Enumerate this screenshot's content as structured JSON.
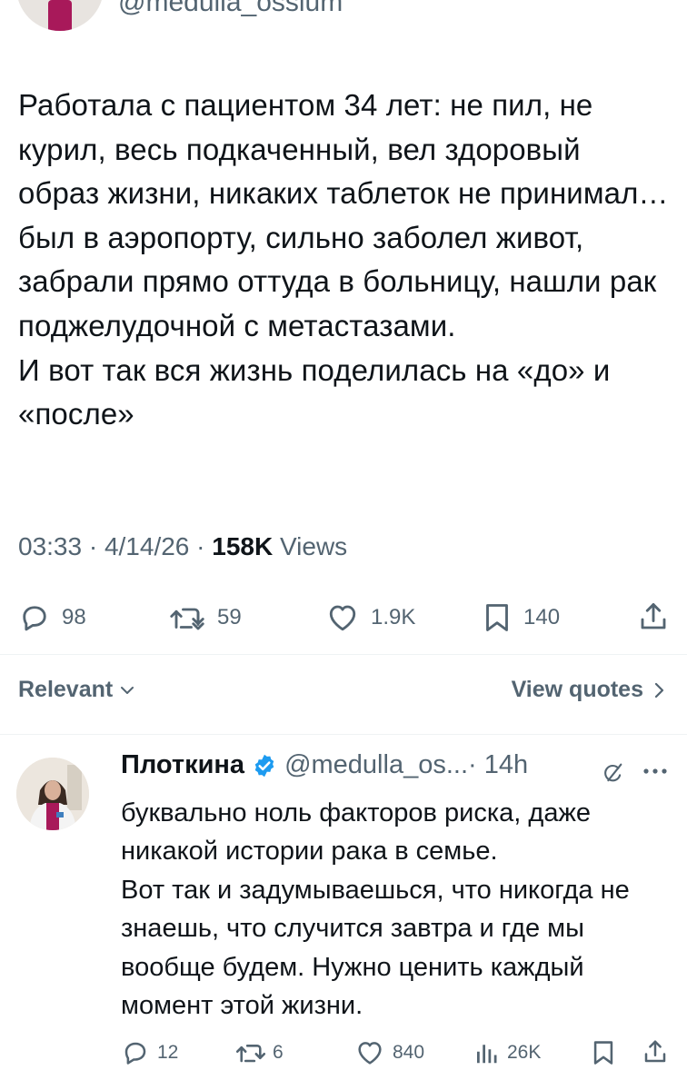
{
  "main_tweet": {
    "handle": "@medulla_ossium",
    "text": "Работала с пациентом 34 лет: не пил, не курил, весь подкаченный, вел здоровый образ жизни, никаких таблеток не принимал…был в аэропорту, сильно заболел живот, забрали прямо оттуда в больницу, нашли рак поджелудочной с метастазами.\nИ вот так вся жизнь поделилась на «до» и «после»",
    "time": "03:33 · 4/14/26 · ",
    "views_count": "158K",
    "views_label": " Views",
    "actions": {
      "replies": "98",
      "reposts": "59",
      "likes": "1.9K",
      "bookmarks": "140"
    }
  },
  "sort": {
    "relevant_label": "Relevant",
    "view_quotes_label": "View quotes"
  },
  "reply": {
    "name": "Плоткина",
    "handle": "@medulla_os...",
    "time": " · 14h",
    "text": "буквально ноль факторов риска, даже никакой истории рака в семье.\nВот так и задумываешься, что никогда не знаешь, что случится завтра и где мы вообще будем. Нужно ценить каждый момент этой жизни.",
    "actions": {
      "replies": "12",
      "reposts": "6",
      "likes": "840",
      "views": "26K"
    }
  },
  "colors": {
    "text": "#0f1419",
    "secondary": "#536471",
    "verified": "#1d9bf0",
    "divider": "#eff3f4"
  },
  "icons": [
    "reply-icon",
    "repost-icon",
    "like-icon",
    "bookmark-icon",
    "share-icon",
    "chevron-down-icon",
    "chevron-right-icon",
    "verified-icon",
    "grok-icon",
    "more-icon",
    "views-icon"
  ]
}
